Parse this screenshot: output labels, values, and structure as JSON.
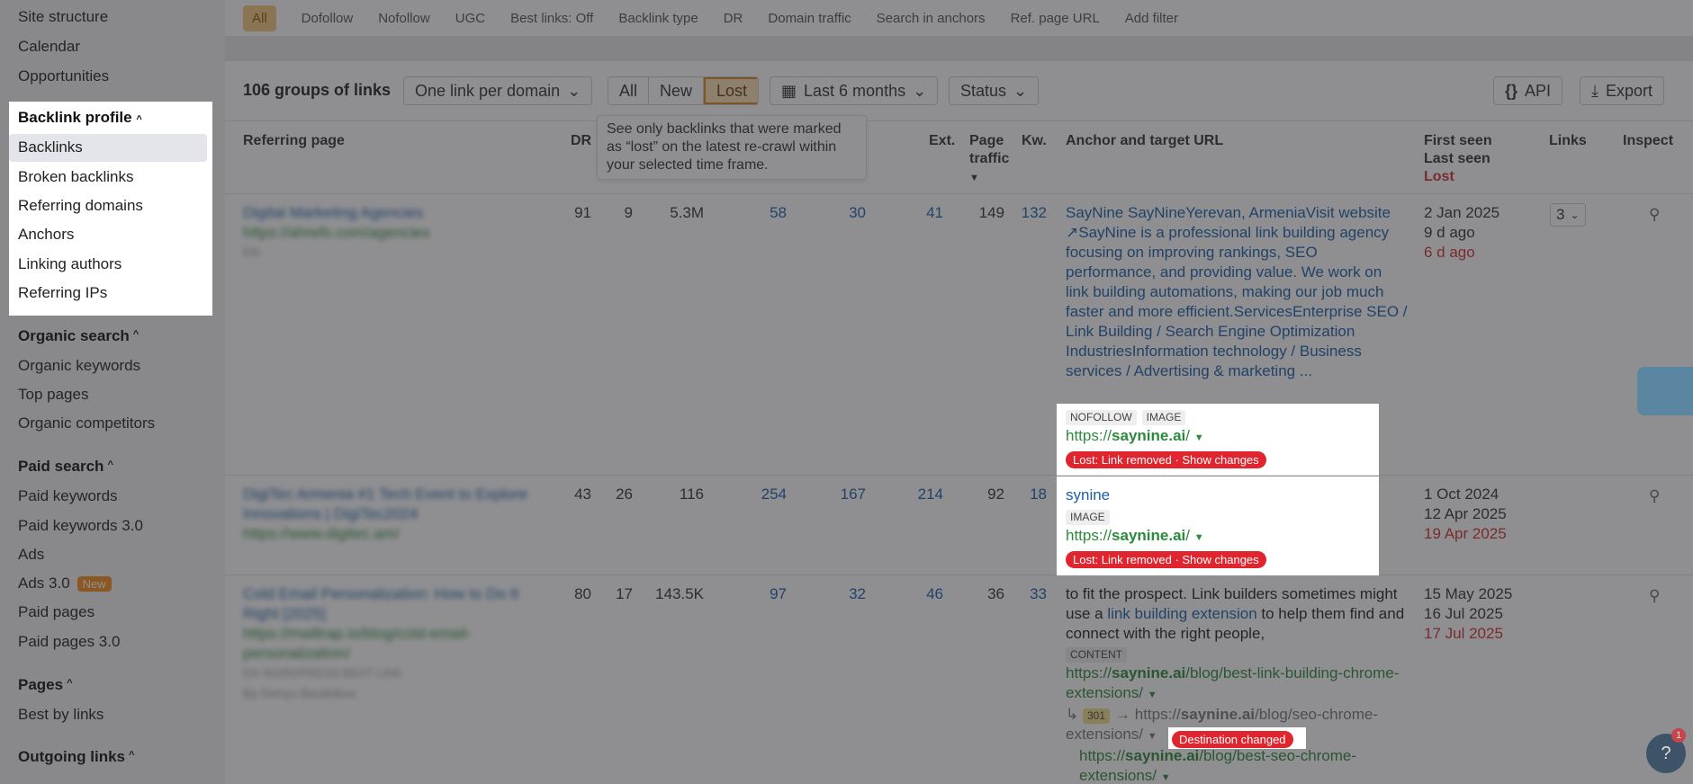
{
  "sidebar": {
    "top_items": [
      "Site structure",
      "Calendar",
      "Opportunities"
    ],
    "backlink_profile": {
      "title": "Backlink profile",
      "items": [
        "Backlinks",
        "Broken backlinks",
        "Referring domains",
        "Anchors",
        "Linking authors",
        "Referring IPs"
      ]
    },
    "organic_search": {
      "title": "Organic search",
      "items": [
        "Organic keywords",
        "Top pages",
        "Organic competitors"
      ]
    },
    "paid_search": {
      "title": "Paid search",
      "items": [
        "Paid keywords",
        "Paid keywords 3.0",
        "Ads",
        "Ads 3.0",
        "Paid pages",
        "Paid pages 3.0"
      ],
      "new_badge": "New"
    },
    "pages": {
      "title": "Pages",
      "items": [
        "Best by links"
      ]
    },
    "outgoing_links": {
      "title": "Outgoing links"
    }
  },
  "filterbar": {
    "chips": [
      "All",
      "Dofollow",
      "Nofollow",
      "UGC",
      "Best links: Off",
      "Backlink type",
      "DR",
      "Domain traffic",
      "Search in anchors",
      "Ref. page URL",
      "Add filter"
    ]
  },
  "toolbar": {
    "count": "106 groups of links",
    "grouping": "One link per domain",
    "seg": [
      "All",
      "New",
      "Lost"
    ],
    "period": "Last 6 months",
    "status": "Status",
    "api": "API",
    "export": "Export"
  },
  "tooltip": "See only backlinks that were marked as “lost” on the latest re-crawl within your selected time frame.",
  "columns": {
    "referring_page": "Referring page",
    "dr": "DR",
    "ext": "Ext.",
    "page_traffic": "Page traffic",
    "kw": "Kw.",
    "anchor": "Anchor and target URL",
    "first_seen": "First seen",
    "last_seen": "Last seen",
    "lost": "Lost",
    "links": "Links",
    "inspect": "Inspect"
  },
  "rows": [
    {
      "title": "Digital Marketing Agencies",
      "url": "https://ahrefs.com/agencies",
      "tag": "EN",
      "dr": "91",
      "c2": "9",
      "c3": "5.3M",
      "c4": "58",
      "c5": "30",
      "ext": "41",
      "traffic": "149",
      "kw": "132",
      "anchor": "SayNine SayNineYerevan, ArmeniaVisit website ↗SayNine is a professional link building agency focusing on improving rankings, SEO performance, and providing value. We work on link building automations, making our job much faster and more efficient.ServicesEnterprise SEO / Link Building / Search Engine Optimization IndustriesInformation technology / Business services / Advertising & marketing ...",
      "tags": [
        "NOFOLLOW",
        "IMAGE"
      ],
      "target_prefix": "https://",
      "target_domain": "saynine.ai",
      "target_suffix": "/",
      "status_pill": "Lost: Link removed · Show changes",
      "first_seen": "2 Jan 2025",
      "last_seen": "9 d ago",
      "lost": "6 d ago",
      "links": "3"
    },
    {
      "title": "DigiTec Armenia #1 Tech Event to Explore Innovations | DigiTec2024",
      "url": "https://www.digitec.am/",
      "dr": "43",
      "c2": "26",
      "c3": "116",
      "c4": "254",
      "c5": "167",
      "ext": "214",
      "traffic": "92",
      "kw": "18",
      "anchor": "synine",
      "tags": [
        "IMAGE"
      ],
      "target_prefix": "https://",
      "target_domain": "saynine.ai",
      "target_suffix": "/",
      "status_pill": "Lost: Link removed · Show changes",
      "first_seen": "1 Oct 2024",
      "last_seen": "12 Apr 2025",
      "lost": "19 Apr 2025"
    },
    {
      "title": "Cold Email Personalization: How to Do It Right [2025]",
      "url": "https://mailtrap.io/blog/cold-email-personalization/",
      "tags_row": [
        "EN",
        "WORDPRESS",
        "BEST LINK"
      ],
      "author": "By Denys Berdnikov",
      "dr": "80",
      "c2": "17",
      "c3": "143.5K",
      "c4": "97",
      "c5": "32",
      "ext": "46",
      "traffic": "36",
      "kw": "33",
      "anchor_before": "to fit the prospect. Link builders sometimes might use a ",
      "anchor_link": "link building extension",
      "anchor_after": " to help them find and connect with the right people,",
      "tags": [
        "CONTENT"
      ],
      "target_prefix": "https://",
      "target_domain": "saynine.ai",
      "target_suffix": "/blog/best-link-building-chrome-extensions/",
      "redirect_code": "301",
      "redirect_prefix": "https://",
      "redirect_domain": "saynine.ai",
      "redirect_suffix": "/blog/seo-chrome-extensions/",
      "dest_pill": "Destination changed",
      "final_prefix": "https://",
      "final_domain": "saynine.ai",
      "final_suffix": "/blog/best-seo-chrome-extensions/",
      "first_seen": "15 May 2025",
      "last_seen": "16 Jul 2025",
      "lost": "17 Jul 2025"
    }
  ],
  "help_badge": "1"
}
